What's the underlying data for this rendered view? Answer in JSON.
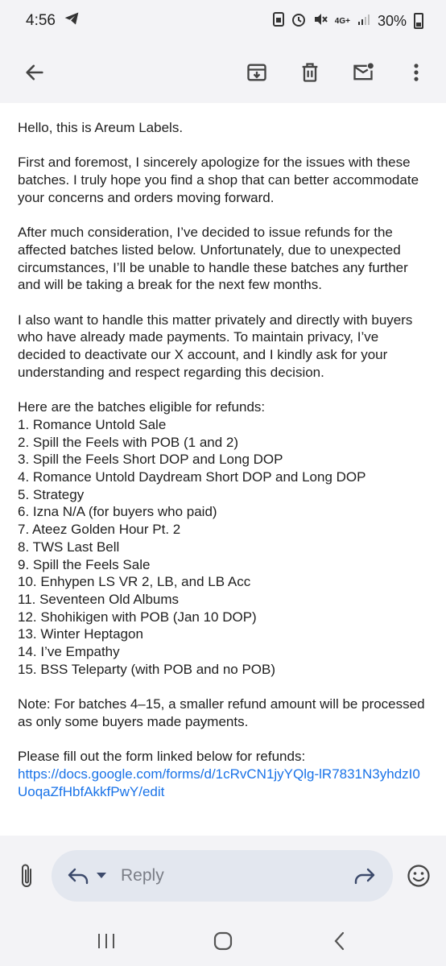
{
  "status": {
    "time": "4:56",
    "network": "4G+",
    "battery": "30%"
  },
  "reply_bar": {
    "reply_label": "Reply"
  },
  "email": {
    "greeting": "Hello, this is Areum Labels.",
    "paragraphs": [
      "First and foremost, I sincerely apologize for the issues with these batches. I truly hope you find a shop that can better accommodate your concerns and orders moving forward.",
      "After much consideration, I’ve decided to issue refunds for the affected batches listed below. Unfortunately, due to unexpected circumstances, I’ll be unable to handle these batches any further and will be taking a break for the next few months.",
      "I also want to handle this matter privately and directly with buyers who have already made payments. To maintain privacy, I’ve decided to deactivate our X account, and I kindly ask for your understanding and respect regarding this decision."
    ],
    "list_intro": "Here are the batches eligible for refunds:",
    "batches": [
      "1. Romance Untold Sale",
      "2. Spill the Feels with POB (1 and 2)",
      "3. Spill the Feels Short DOP and Long DOP",
      "4. Romance Untold Daydream Short DOP and Long DOP",
      "5. Strategy",
      "6. Izna N/A (for buyers who paid)",
      "7. Ateez Golden Hour Pt. 2",
      "8. TWS Last Bell",
      "9. Spill the Feels Sale",
      "10. Enhypen LS VR 2, LB, and LB Acc",
      "11. Seventeen Old Albums",
      "12. Shohikigen with POB (Jan 10 DOP)",
      "13. Winter Heptagon",
      "14. I’ve Empathy",
      "15. BSS Teleparty (with POB and no POB)"
    ],
    "note": "Note: For batches 4–15, a smaller refund amount will be processed as only some buyers made payments.",
    "form_intro": "Please fill out the form linked below for refunds:",
    "form_link": "https://docs.google.com/forms/d/1cRvCN1jyYQlg-lR7831N3yhdzI0UoqaZfHbfAkkfPwY/edit"
  }
}
